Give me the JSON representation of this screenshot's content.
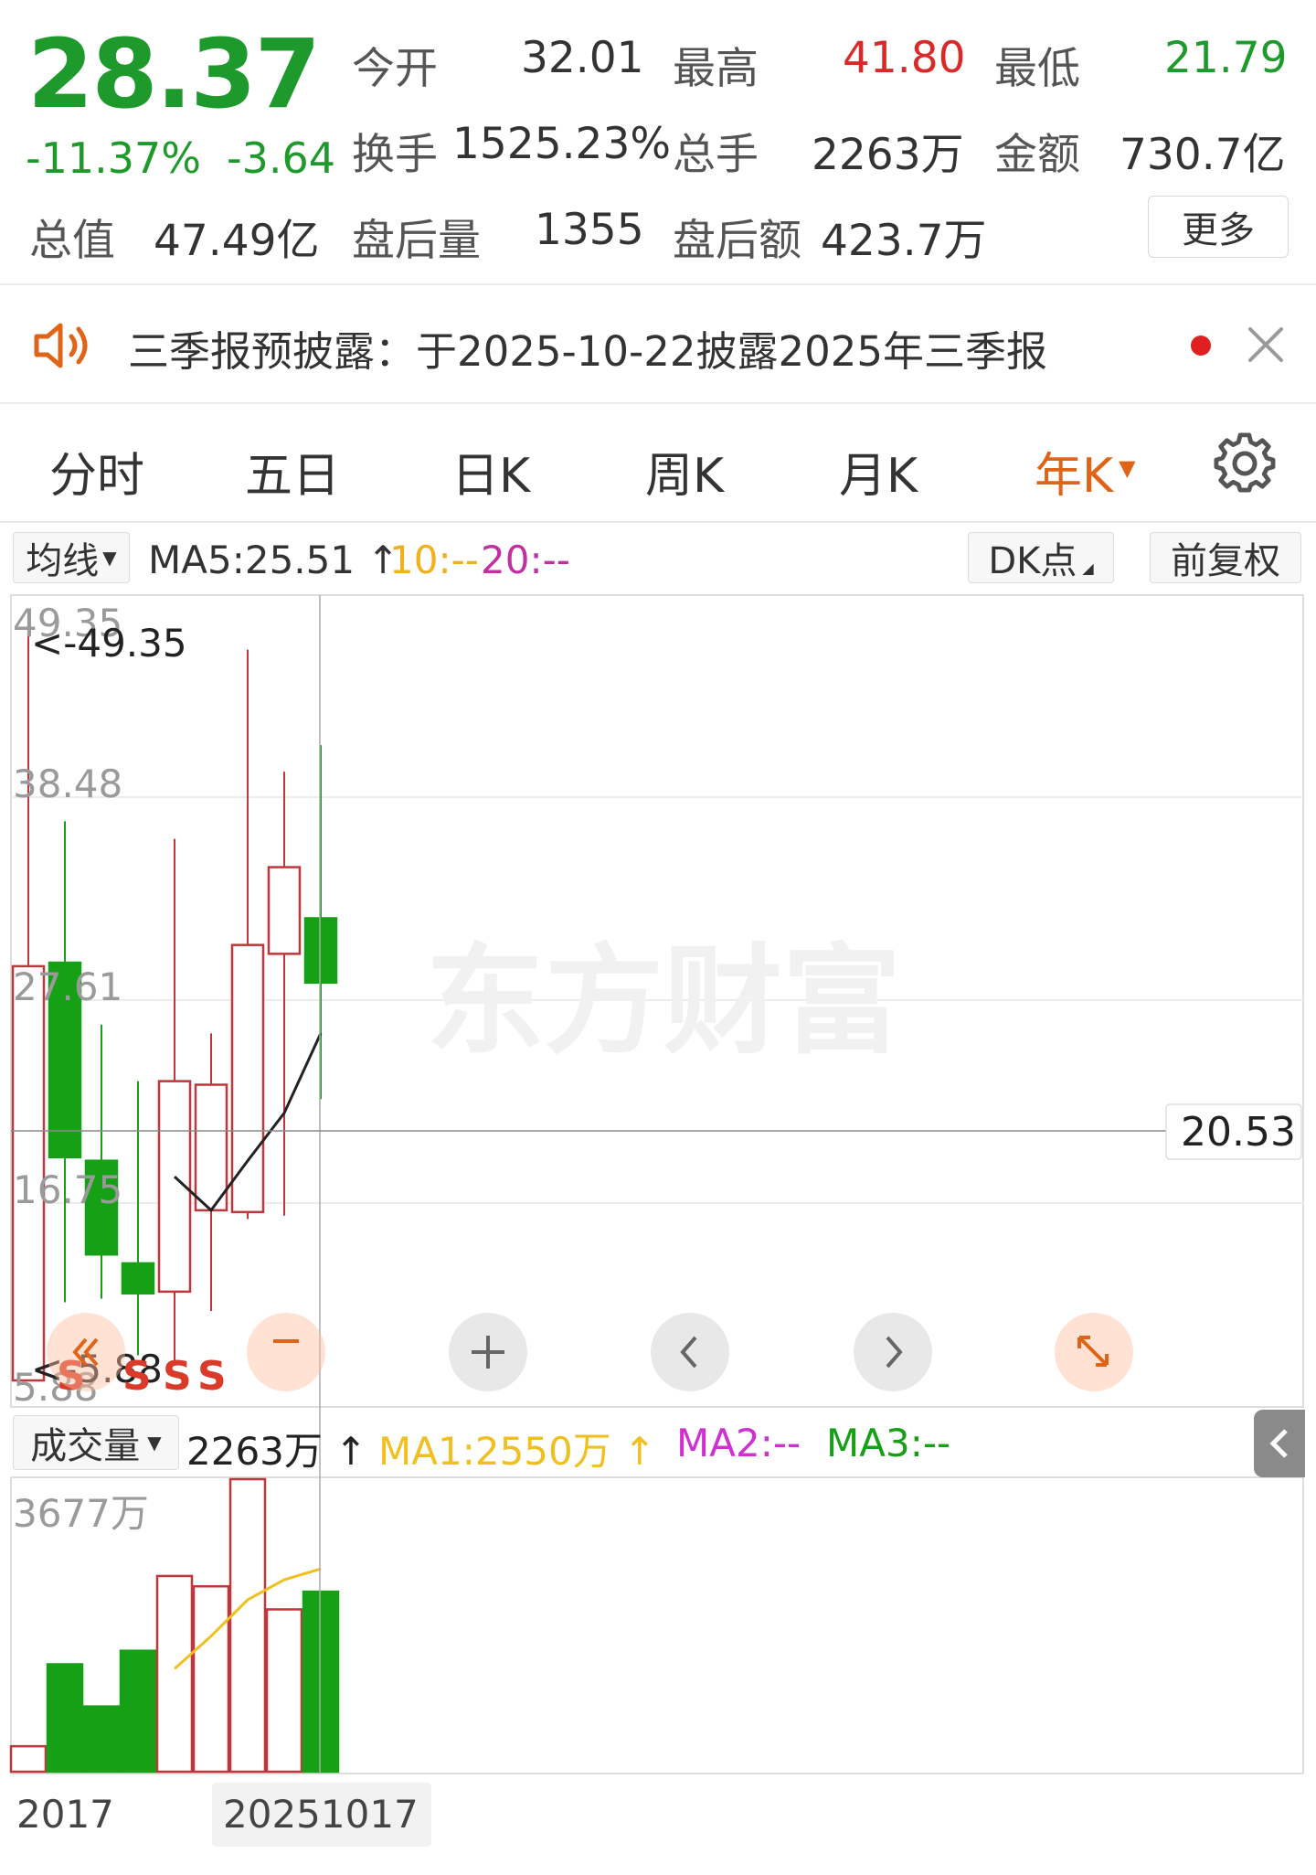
{
  "quote": {
    "price": "28.37",
    "change_pct": "-11.37%",
    "change_amt": "-3.64",
    "open_label": "今开",
    "open_value": "32.01",
    "high_label": "最高",
    "high_value": "41.80",
    "low_label": "最低",
    "low_value": "21.79",
    "turnover_label": "换手",
    "turnover_value": "1525.23%",
    "volume_label": "总手",
    "volume_value": "2263万",
    "amount_label": "金额",
    "amount_value": "730.7亿",
    "mktcap_label": "总值",
    "mktcap_value": "47.49亿",
    "ah_vol_label": "盘后量",
    "ah_vol_value": "1355",
    "ah_amt_label": "盘后额",
    "ah_amt_value": "423.7万",
    "more_label": "更多"
  },
  "notice": {
    "text": "三季报预披露：于2025-10-22披露2025年三季报",
    "icon": "speaker-icon"
  },
  "tabs": [
    {
      "label": "分时"
    },
    {
      "label": "五日"
    },
    {
      "label": "日K"
    },
    {
      "label": "周K"
    },
    {
      "label": "月K"
    },
    {
      "label": "年K",
      "active": true
    }
  ],
  "chart_toolbar": {
    "indicator": "均线",
    "ma5": "MA5:25.51",
    "ma10": "10:--",
    "ma20": "20:--",
    "dk_label": "DK点",
    "adjust_label": "前复权"
  },
  "volume_toolbar": {
    "indicator": "成交量",
    "volume": "2263万",
    "ma1": "MA1:2550万",
    "ma2": "MA2:--",
    "ma3": "MA3:--"
  },
  "price_axis": {
    "labels": [
      "49.35",
      "38.48",
      "27.61",
      "16.75",
      "5.88"
    ],
    "max_marker": "<-49.35",
    "min_marker": "<-5.88",
    "crosshair_value": "20.53"
  },
  "volume_axis": {
    "max_label": "3677万"
  },
  "watermark": "东方财富",
  "signals": [
    "S",
    "S",
    "S",
    "S"
  ],
  "x_axis": {
    "start": "2017",
    "cursor_date": "20251017"
  },
  "colors": {
    "up": "#c0363a",
    "down": "#16a016",
    "accent": "#e06418",
    "ma1": "#f0c020",
    "ma2": "#d030d0",
    "ma3": "#16a016"
  },
  "chart_data": {
    "type": "candlestick",
    "candles": [
      {
        "open": 5.88,
        "close": 29.3,
        "high": 49.35,
        "low": 5.88
      },
      {
        "open": 29.5,
        "close": 18.5,
        "high": 37.5,
        "low": 10.3
      },
      {
        "open": 18.3,
        "close": 13.0,
        "high": 26.0,
        "low": 10.5
      },
      {
        "open": 12.5,
        "close": 10.8,
        "high": 22.8,
        "low": 7.3
      },
      {
        "open": 10.9,
        "close": 22.8,
        "high": 36.5,
        "low": 7.0
      },
      {
        "open": 15.5,
        "close": 22.6,
        "high": 25.5,
        "low": 9.8
      },
      {
        "open": 15.4,
        "close": 30.5,
        "high": 47.2,
        "low": 15.0
      },
      {
        "open": 30.0,
        "close": 34.9,
        "high": 40.3,
        "low": 15.2
      },
      {
        "open": 32.01,
        "close": 28.37,
        "high": 41.8,
        "low": 21.79
      }
    ],
    "ma5": [
      null,
      null,
      null,
      null,
      17.4,
      15.5,
      18.3,
      21.0,
      25.51
    ],
    "volume": [
      320,
      1350,
      820,
      1520,
      2460,
      2330,
      3677,
      2040,
      2263
    ],
    "volume_ma1": [
      null,
      null,
      null,
      null,
      1294,
      1704,
      2161,
      2413,
      2550
    ],
    "ylim": [
      5.88,
      49.35
    ],
    "vol_max": 3677
  }
}
